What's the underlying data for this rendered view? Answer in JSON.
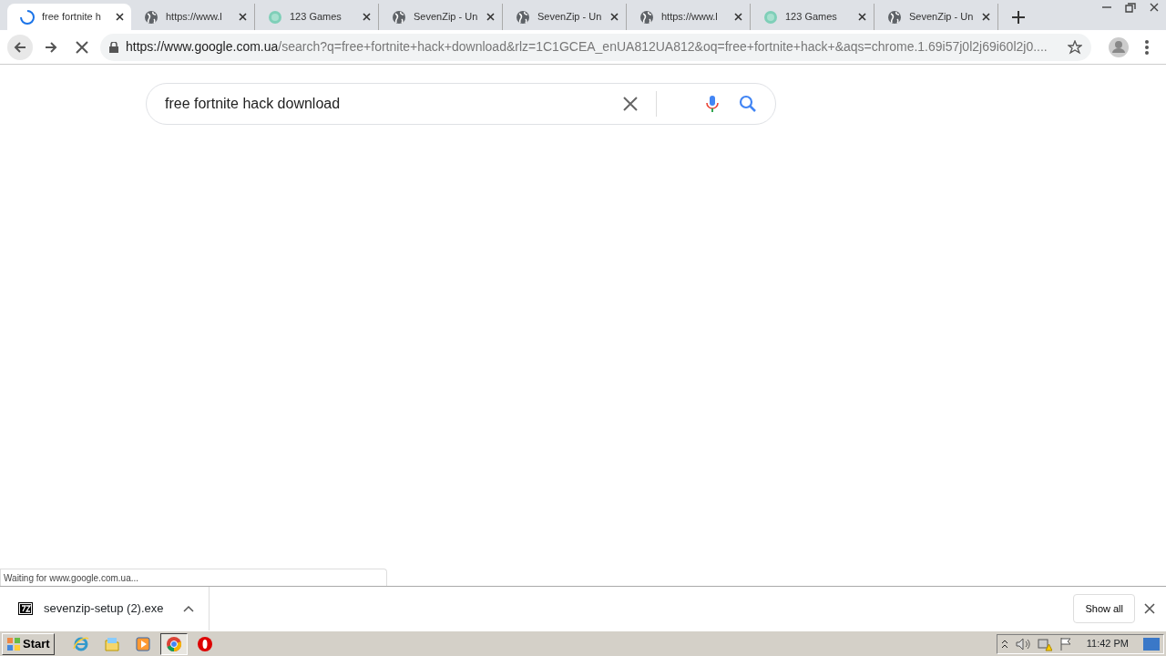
{
  "tabs": [
    {
      "title": "free fortnite h",
      "kind": "loading",
      "selected": true
    },
    {
      "title": "https://www.l",
      "kind": "web",
      "selected": false
    },
    {
      "title": "123 Games",
      "kind": "site",
      "selected": false
    },
    {
      "title": "SevenZip - Un",
      "kind": "web",
      "selected": false
    },
    {
      "title": "SevenZip - Un",
      "kind": "web",
      "selected": false
    },
    {
      "title": "https://www.l",
      "kind": "web",
      "selected": false
    },
    {
      "title": "123 Games",
      "kind": "site",
      "selected": false
    },
    {
      "title": "SevenZip - Un",
      "kind": "web",
      "selected": false
    }
  ],
  "address": {
    "host": "https://www.google.com.ua",
    "rest": "/search?q=free+fortnite+hack+download&rlz=1C1GCEA_enUA812UA812&oq=free+fortnite+hack+&aqs=chrome.1.69i57j0l2j69i60l2j0...."
  },
  "search": {
    "value": "free fortnite hack download"
  },
  "status": "Waiting for www.google.com.ua...",
  "download": {
    "file": "sevenzip-setup (2).exe",
    "button": "Show all"
  },
  "taskbar": {
    "start": "Start",
    "apps": [
      {
        "selected": false
      },
      {
        "selected": false
      },
      {
        "selected": false
      },
      {
        "selected": true
      },
      {
        "selected": false
      }
    ],
    "clock": "11:42 PM"
  }
}
